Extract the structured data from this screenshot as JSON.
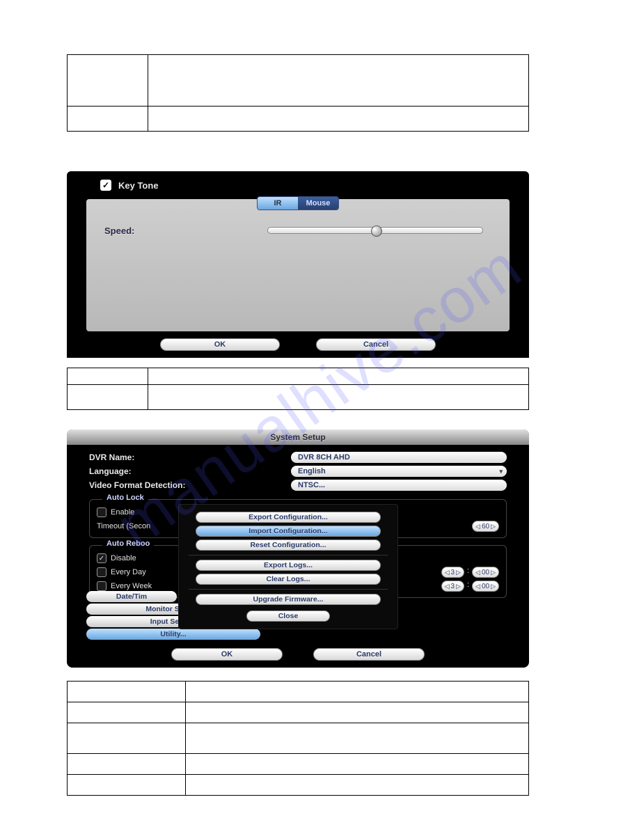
{
  "watermark": "manualhive.com",
  "shot1": {
    "checkbox_label": "Key Tone",
    "tab_ir": "IR",
    "tab_mouse": "Mouse",
    "speed_label": "Speed:",
    "ok": "OK",
    "cancel": "Cancel"
  },
  "shot2": {
    "title": "System Setup",
    "dvr_name_label": "DVR Name:",
    "dvr_name_value": "DVR 8CH AHD",
    "language_label": "Language:",
    "language_value": "English",
    "vfd_label": "Video Format Detection:",
    "vfd_value": "NTSC...",
    "autolock_title": "Auto Lock",
    "enable": "Enable",
    "timeout": "Timeout (Secon",
    "timeout_value": "60",
    "autoreboot_title": "Auto Reboo",
    "disable": "Disable",
    "every_day": "Every Day",
    "every_week": "Every Week",
    "time_h": "3",
    "time_m": "00",
    "menu_datetime": "Date/Tim",
    "menu_monitor": "Monitor Setup...",
    "menu_input": "Input Setup...",
    "menu_utility": "Utility...",
    "ok": "OK",
    "cancel": "Cancel",
    "popup": {
      "export_config": "Export Configuration...",
      "import_config": "Import Configuration...",
      "reset_config": "Reset Configuration...",
      "export_logs": "Export Logs...",
      "clear_logs": "Clear Logs...",
      "upgrade_fw": "Upgrade Firmware...",
      "close": "Close"
    }
  },
  "table1": {
    "r0c0": "",
    "r0c1": "",
    "r1c0": "",
    "r1c1": ""
  },
  "table2": {
    "r0c0": "",
    "r0c1": "",
    "r1c0": "",
    "r1c1": ""
  },
  "table3": {
    "r0c0": "",
    "r0c1": "",
    "r1c0": "",
    "r1c1": "",
    "r2c0": "",
    "r2c1": "",
    "r3c0": "",
    "r3c1": "",
    "r4c0": "",
    "r4c1": ""
  }
}
